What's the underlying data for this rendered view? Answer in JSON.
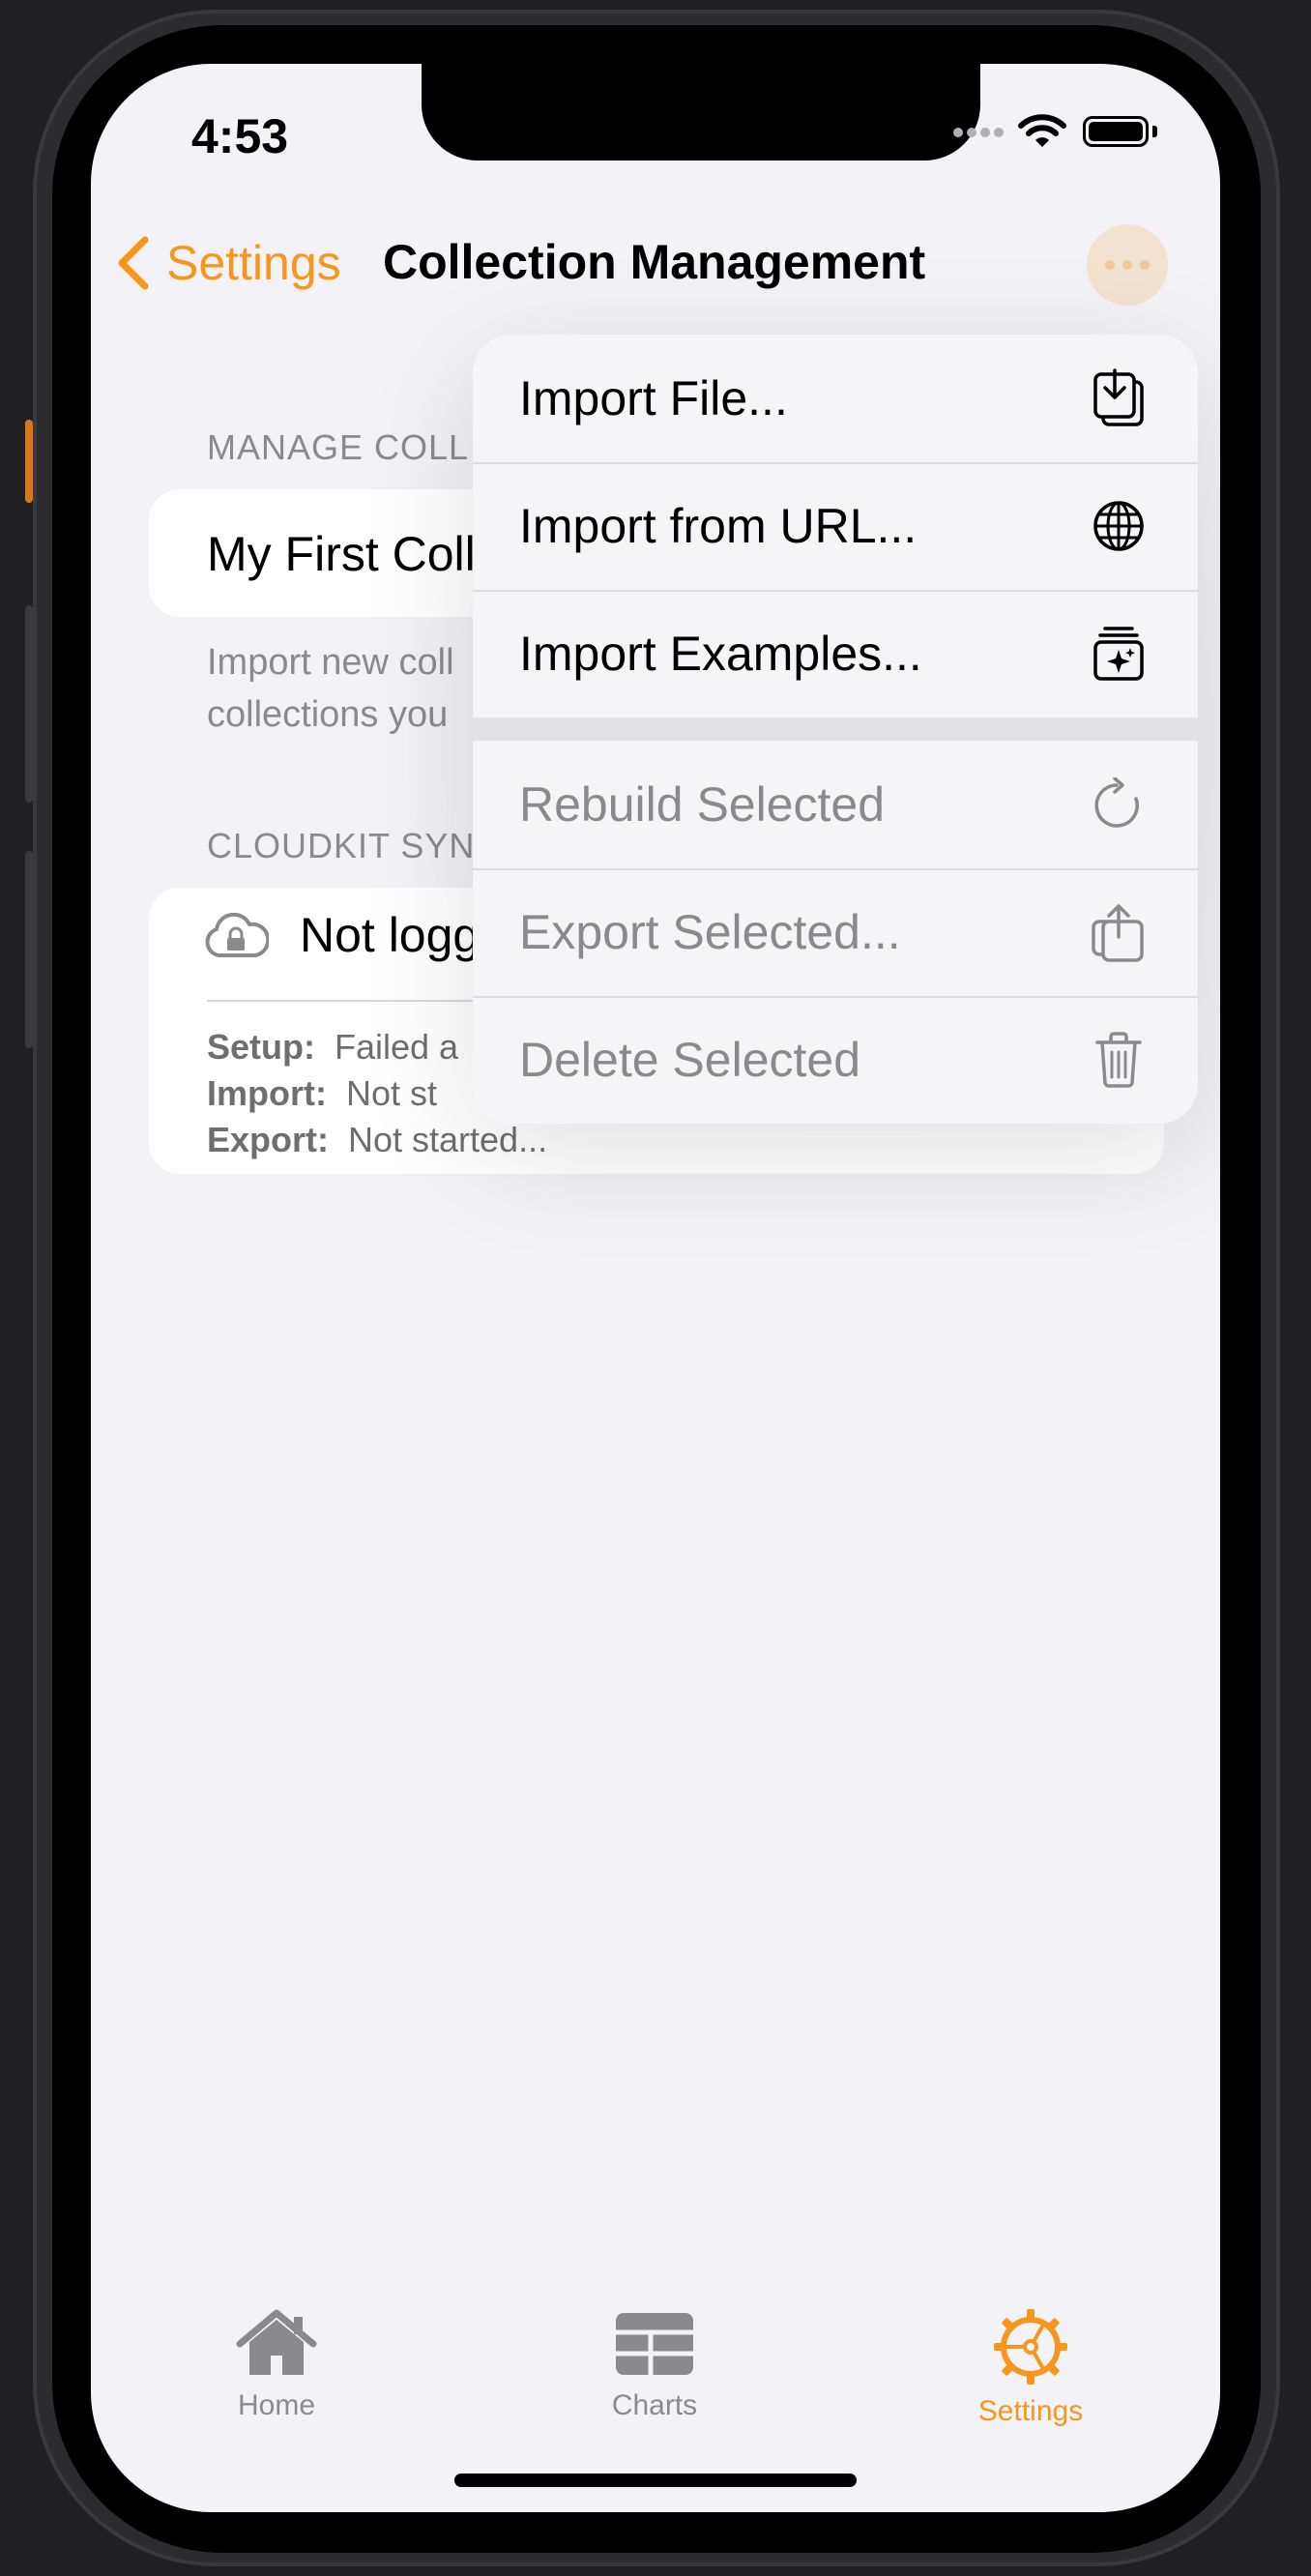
{
  "status_bar": {
    "time": "4:53"
  },
  "nav": {
    "back_label": "Settings",
    "title": "Collection Management"
  },
  "manage_section": {
    "header": "MANAGE COLL",
    "row": "My First Coll",
    "footer_line1": "Import new coll",
    "footer_line2": "collections you"
  },
  "sync_section": {
    "header": "CLOUDKIT SYN",
    "status": "Not logg",
    "setup_label": "Setup:",
    "setup_value": "Failed a",
    "import_label": "Import:",
    "import_value": "Not st",
    "export_label": "Export:",
    "export_value": "Not started..."
  },
  "menu": {
    "import_file": "Import File...",
    "import_url": "Import from URL...",
    "import_examples": "Import Examples...",
    "rebuild": "Rebuild Selected",
    "export": "Export Selected...",
    "delete": "Delete Selected"
  },
  "tabs": {
    "home": "Home",
    "charts": "Charts",
    "settings": "Settings"
  },
  "colors": {
    "accent": "#f7961c",
    "background": "#f2f2f7",
    "secondary_text": "#8a8a8e"
  }
}
